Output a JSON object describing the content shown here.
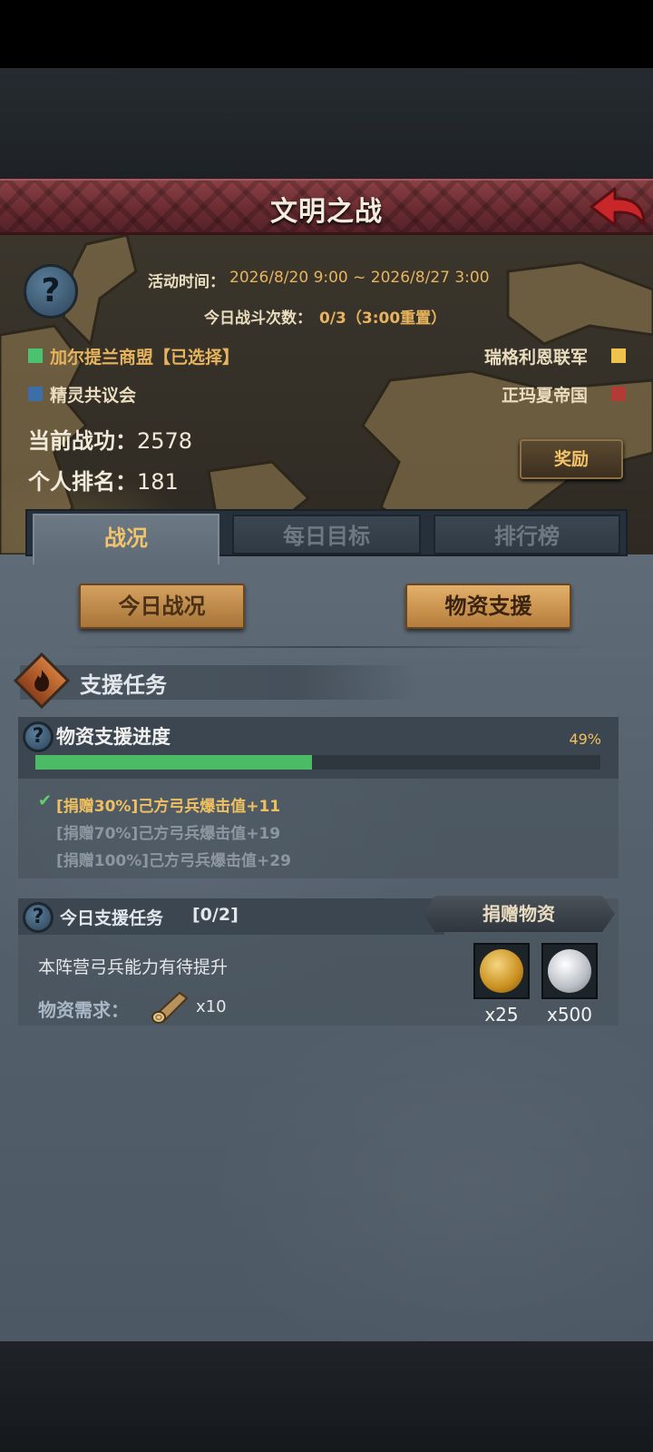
{
  "header": {
    "title": "文明之战"
  },
  "event": {
    "time_label": "活动时间：",
    "time_value": "2026/8/20 9:00 ~ 2026/8/27 3:00",
    "battles_label": "今日战斗次数：",
    "battles_value": "0/3（3:00重置）"
  },
  "factions": [
    {
      "name": "加尔提兰商盟【已选择】",
      "color": "#4bc26f"
    },
    {
      "name": "精灵共议会",
      "color": "#3c6eaa"
    },
    {
      "name": "瑞格利恩联军",
      "color": "#efc24e"
    },
    {
      "name": "正玛夏帝国",
      "color": "#b23b35"
    }
  ],
  "stats": {
    "merit_label": "当前战功：",
    "merit_value": "2578",
    "rank_label": "个人排名：",
    "rank_value": "181"
  },
  "reward_button": "奖励",
  "tabs": [
    {
      "label": "战况",
      "active": true
    },
    {
      "label": "每日目标",
      "active": false
    },
    {
      "label": "排行榜",
      "active": false
    }
  ],
  "subtabs": {
    "today": "今日战况",
    "supply": "物资支援"
  },
  "section": {
    "title": "支援任务"
  },
  "progress": {
    "title": "物资支援进度",
    "percent_text": "49%",
    "percent": 49,
    "tiers": [
      {
        "text": "[捐赠30%]己方弓兵爆击值+11",
        "done": true
      },
      {
        "text": "[捐赠70%]己方弓兵爆击值+19",
        "done": false
      },
      {
        "text": "[捐赠100%]己方弓兵爆击值+29",
        "done": false
      }
    ]
  },
  "task": {
    "title": "今日支援任务",
    "count": "[0/2]",
    "donate_button": "捐赠物资",
    "description": "本阵营弓兵能力有待提升",
    "requirement_label": "物资需求：",
    "requirement_item": "log-icon",
    "requirement_count": "x10",
    "rewards": [
      {
        "icon": "gold-coin-icon",
        "count": "x25"
      },
      {
        "icon": "silver-coin-icon",
        "count": "x500"
      }
    ]
  },
  "colors": {
    "accent": "#e7b45d",
    "progress": "#4cbb65",
    "title_bar": "#7a353a"
  }
}
